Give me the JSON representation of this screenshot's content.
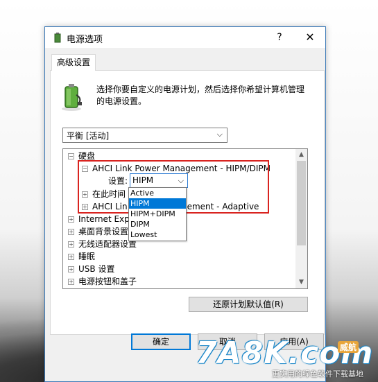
{
  "window": {
    "title": "电源选项",
    "help": "?",
    "close": "✕"
  },
  "tab": {
    "label": "高级设置"
  },
  "description": "选择你要自定义的电源计划，然后选择你希望计算机管理的电源设置。",
  "plan_select": {
    "value": "平衡 [活动]"
  },
  "tree": {
    "items": [
      {
        "label": "硬盘",
        "expander": "⊟"
      },
      {
        "label": "AHCI Link Power Management - HIPM/DIPM",
        "expander": "⊟"
      },
      {
        "label": "设置:"
      },
      {
        "label": "在此时间",
        "expander": "⊞"
      },
      {
        "label_left": "AHCI Lin",
        "label_right": "ement - Adaptive",
        "expander": "⊞"
      },
      {
        "label": "Internet Explo",
        "expander": "⊞"
      },
      {
        "label": "桌面背景设置",
        "expander": "⊞"
      },
      {
        "label": "无线适配器设置",
        "expander": "⊞"
      },
      {
        "label": "睡眠",
        "expander": "⊞"
      },
      {
        "label": "USB 设置",
        "expander": "⊞"
      },
      {
        "label": "电源按钮和盖子",
        "expander": "⊞"
      }
    ],
    "setting_value": "HIPM"
  },
  "dropdown": {
    "options": [
      "Active",
      "HIPM",
      "HIPM+DIPM",
      "DIPM",
      "Lowest"
    ],
    "selected": "HIPM"
  },
  "buttons": {
    "restore": "还原计划默认值(R)",
    "ok": "确定",
    "cancel": "取消",
    "apply": "应用(A)"
  },
  "watermark": {
    "logo": "7A8K.com",
    "badge": "威航",
    "slogan": "更实用的绿色软件下载基地"
  },
  "colors": {
    "accent": "#0078d7",
    "highlight_border": "#d9231f"
  }
}
